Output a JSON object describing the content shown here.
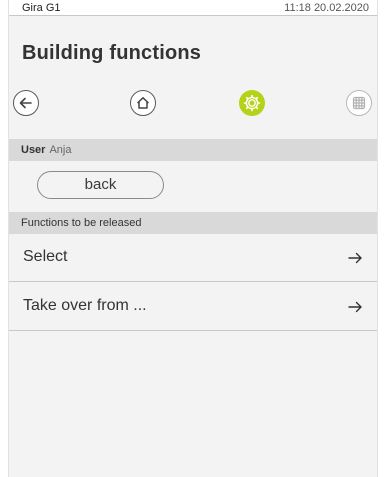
{
  "status_bar": {
    "device": "Gira G1",
    "datetime": "11:18 20.02.2020"
  },
  "page": {
    "title": "Building functions"
  },
  "toolbar": {
    "buttons": [
      {
        "icon": "back-arrow-icon"
      },
      {
        "icon": "home-icon"
      },
      {
        "icon": "functions-gear-icon",
        "active": true,
        "active_color": "#b5d219"
      },
      {
        "icon": "grid-icon",
        "disabled": true
      }
    ]
  },
  "user_section": {
    "label": "User",
    "value": "Anja"
  },
  "back_button": {
    "label": "back"
  },
  "release_section": {
    "label": "Functions to be released"
  },
  "items": [
    {
      "label": "Select",
      "icon": "arrow-right-icon"
    },
    {
      "label": "Take over from ...",
      "icon": "arrow-right-icon"
    }
  ],
  "colors": {
    "accent": "#b5d219",
    "background": "#f3f3f3",
    "section_header": "#d9d9d9"
  }
}
